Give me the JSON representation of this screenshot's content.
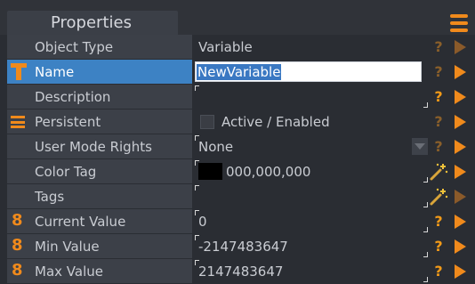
{
  "panel": {
    "title": "Properties",
    "menu_icon": "hamburger-menu-icon",
    "accent_color": "#f08a1c",
    "selected_color": "#3d82c4"
  },
  "properties": {
    "object_type": {
      "label": "Object Type",
      "value": "Variable"
    },
    "name": {
      "label": "Name",
      "value": "NewVariable",
      "icon": "text-t-icon"
    },
    "description": {
      "label": "Description",
      "value": ""
    },
    "persistent": {
      "label": "Persistent",
      "value": "Active / Enabled",
      "checked": false,
      "icon": "list-lines-icon"
    },
    "user_mode_rights": {
      "label": "User Mode Rights",
      "value": "None"
    },
    "color_tag": {
      "label": "Color Tag",
      "value": "000,000,000",
      "swatch": "#000000"
    },
    "tags": {
      "label": "Tags",
      "value": ""
    },
    "current_value": {
      "label": "Current Value",
      "value": "0",
      "icon": "eight-icon"
    },
    "min_value": {
      "label": "Min Value",
      "value": "-2147483647",
      "icon": "eight-icon"
    },
    "max_value": {
      "label": "Max Value",
      "value": "2147483647",
      "icon": "eight-icon"
    }
  },
  "actions": {
    "help_glyph": "?",
    "help_icon": "question-icon",
    "apply_icon": "play-icon",
    "wand_icon": "magic-wand-icon"
  }
}
